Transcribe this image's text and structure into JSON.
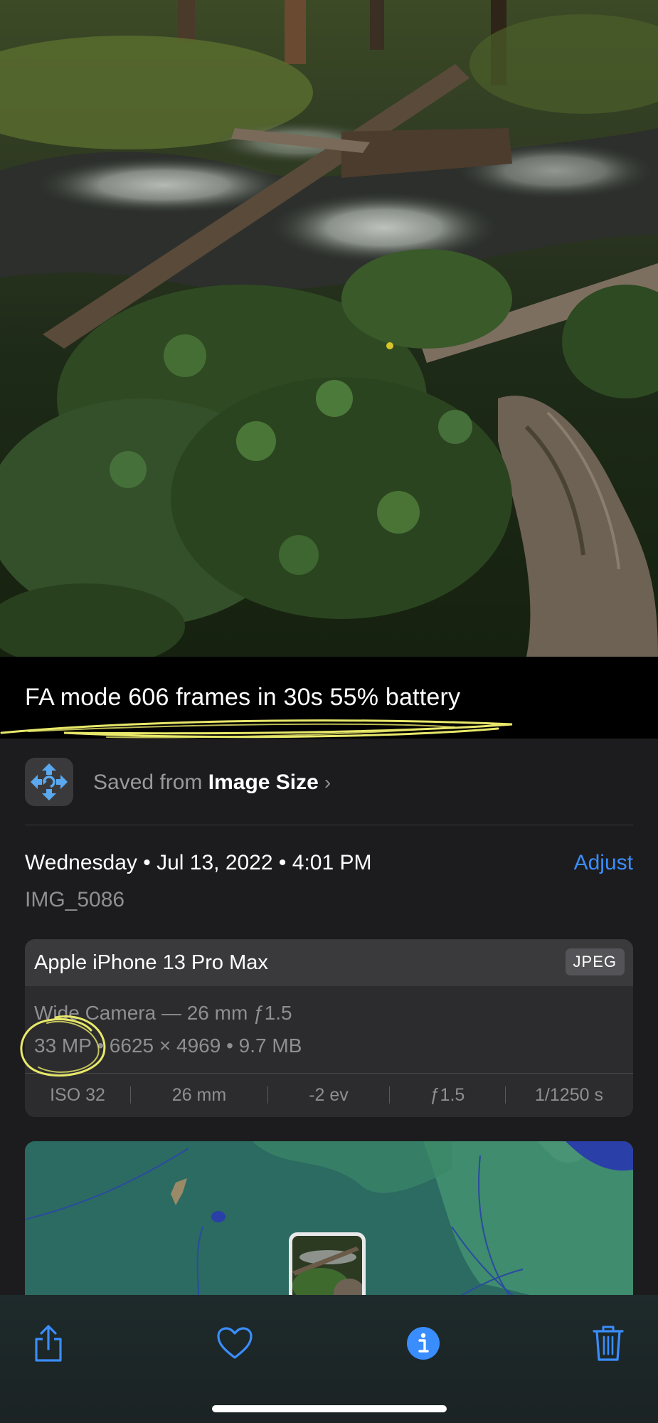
{
  "caption": {
    "text": "FA mode 606 frames in 30s 55% battery"
  },
  "saved_from": {
    "prefix": "Saved from",
    "app_name": "Image Size",
    "chevron": "›",
    "icon": "image-size-app-icon"
  },
  "capture": {
    "day": "Wednesday",
    "date": "Jul 13, 2022",
    "time": "4:01 PM",
    "separator": "•",
    "adjust_label": "Adjust",
    "filename": "IMG_5086"
  },
  "metadata": {
    "device": "Apple iPhone 13 Pro Max",
    "format": "JPEG",
    "lens": "Wide Camera — 26 mm ƒ1.5",
    "resolution_mp": "33 MP",
    "dimensions": "6625 × 4969",
    "file_size": "9.7 MB",
    "exif": {
      "iso": "ISO 32",
      "focal_length": "26 mm",
      "exposure_bias": "-2 ev",
      "aperture": "ƒ1.5",
      "shutter": "1/1250 s"
    }
  },
  "toolbar": {
    "share_icon": "share-icon",
    "favorite_icon": "heart-icon",
    "info_icon": "info-icon",
    "delete_icon": "trash-icon"
  },
  "colors": {
    "accent": "#3a8dfd",
    "panel_bg": "#1c1c1e",
    "card_bg": "#2c2c2e",
    "highlighter": "#e8e86a",
    "map_bg": "#2b6b61"
  }
}
